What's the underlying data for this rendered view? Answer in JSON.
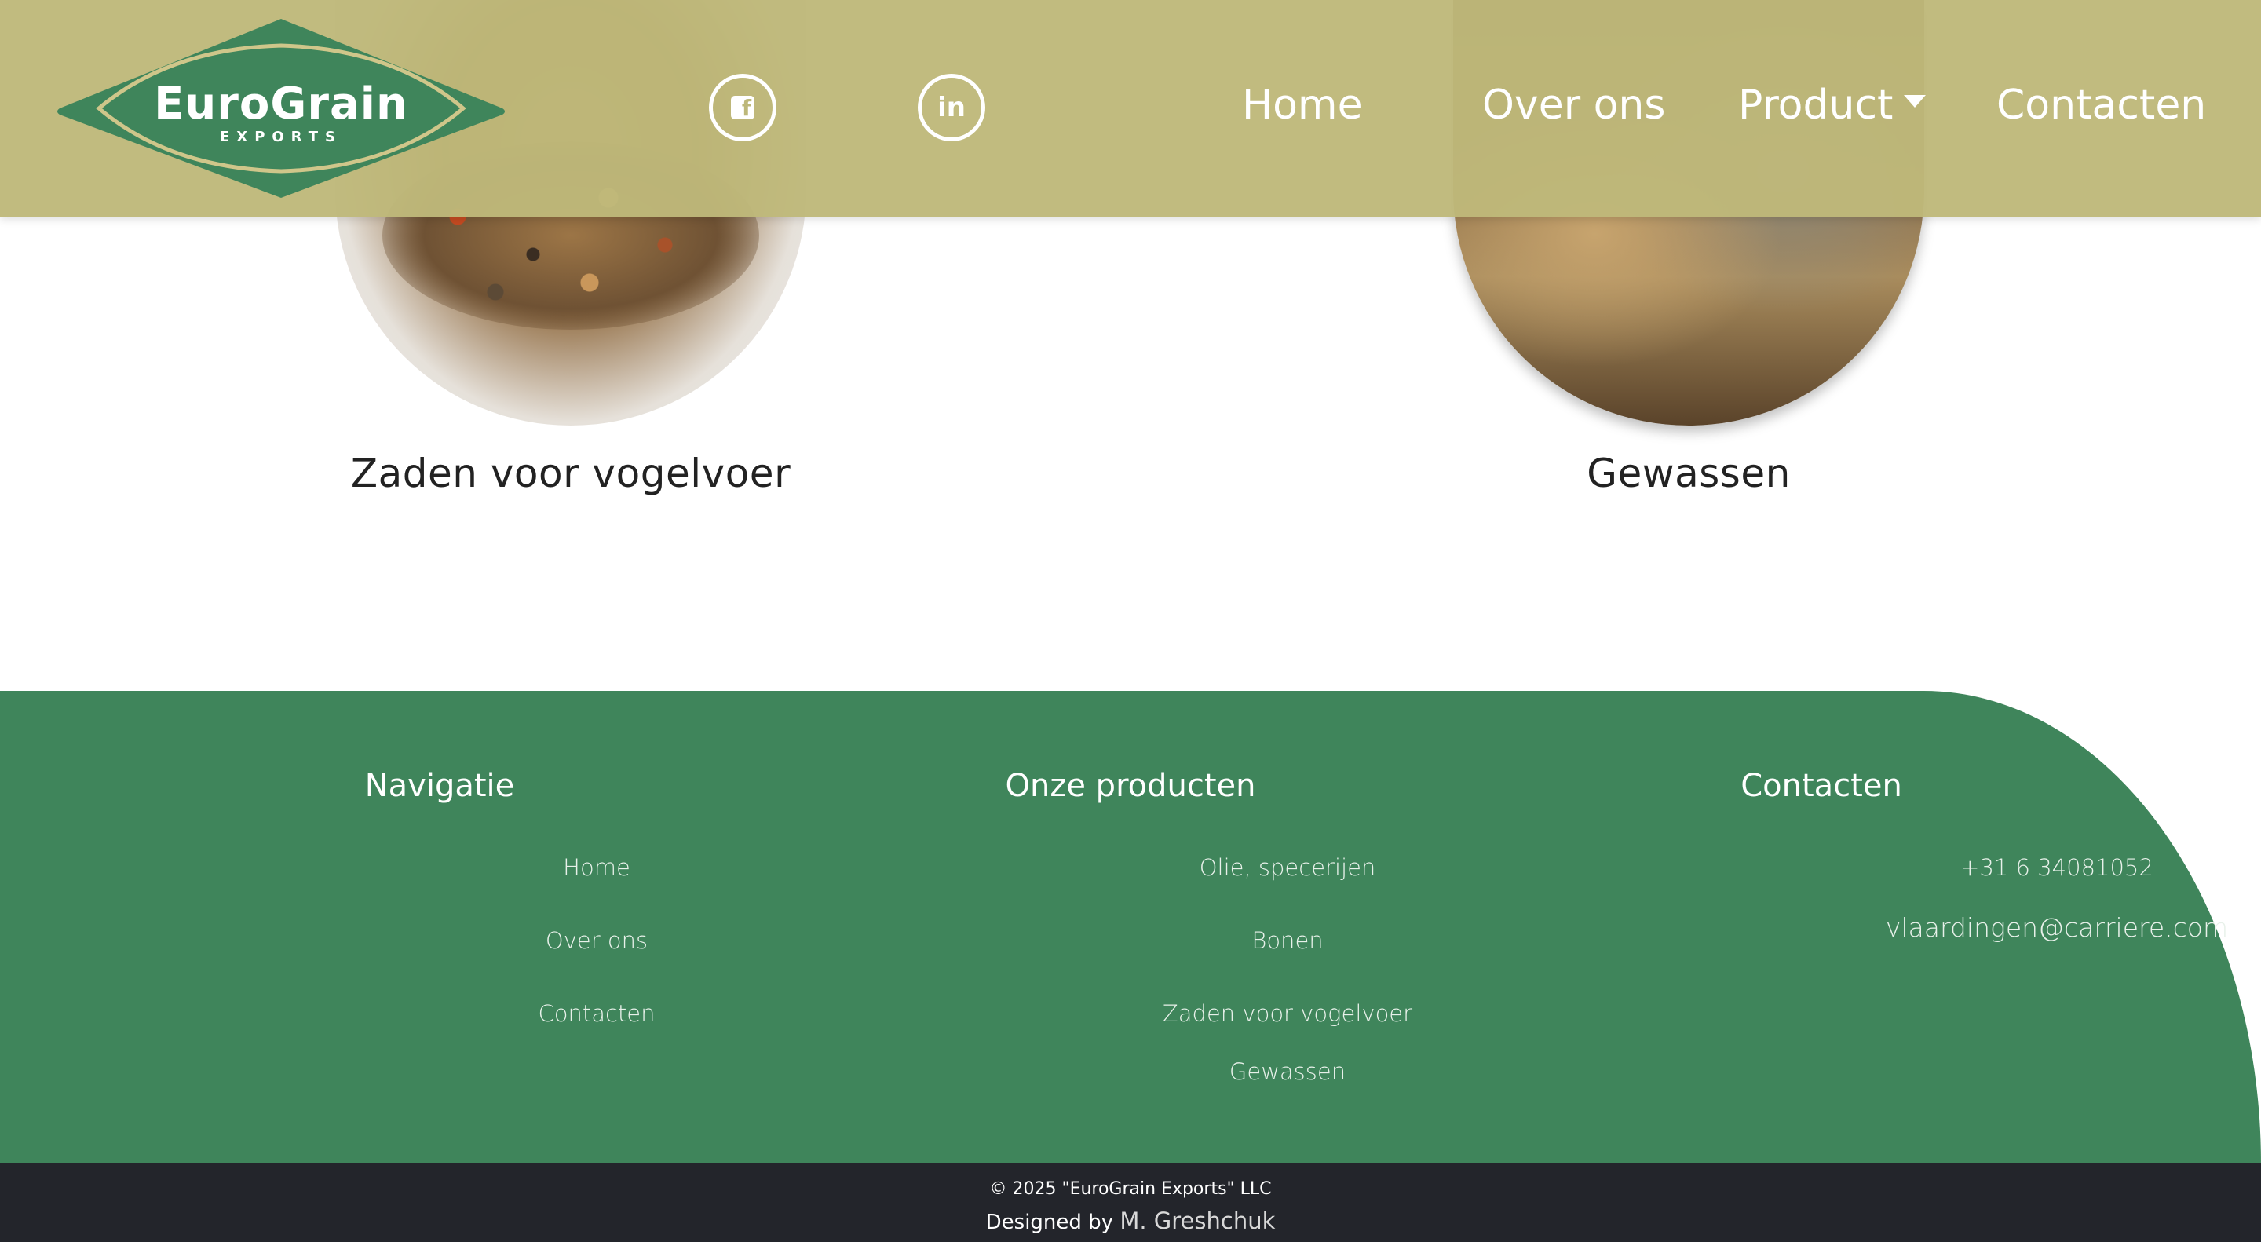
{
  "brand": {
    "name": "EuroGrain",
    "tagline": "EXPORTS",
    "colors": {
      "header": "#bfb87a",
      "logo_green": "#3f855b",
      "footer": "#3f855b",
      "bottom_bar": "#23252b"
    }
  },
  "social": [
    {
      "icon": "facebook-icon",
      "glyph": "f"
    },
    {
      "icon": "linkedin-icon",
      "glyph": "in"
    }
  ],
  "nav": {
    "home": "Home",
    "over_ons": "Over ons",
    "product": "Product",
    "contacten": "Contacten"
  },
  "products": [
    {
      "title": "Zaden voor vogelvoer"
    },
    {
      "title": "Gewassen"
    }
  ],
  "footer": {
    "navigatie": {
      "heading": "Navigatie",
      "items": [
        "Home",
        "Over ons",
        "Contacten"
      ]
    },
    "producten": {
      "heading": "Onze producten",
      "items": [
        "Olie, specerijen",
        "Bonen",
        "Zaden voor vogelvoer",
        "Gewassen"
      ]
    },
    "contacten": {
      "heading": "Contacten",
      "phone": "+31 6 34081052",
      "email": "vlaardingen@carriere.com"
    }
  },
  "bottom": {
    "copyright": "© 2025 \"EuroGrain Exports\" LLC",
    "designed_by_label": "Designed by",
    "designer": "M. Greshchuk"
  }
}
